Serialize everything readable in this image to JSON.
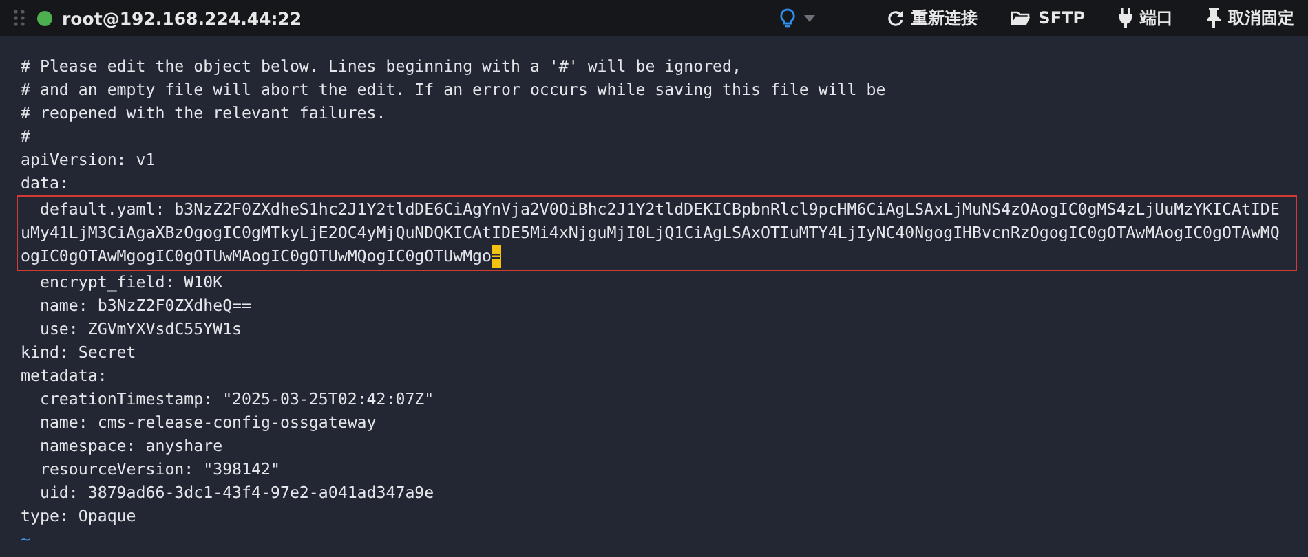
{
  "titlebar": {
    "connected": true,
    "title": "root@192.168.224.44:22",
    "actions": [
      {
        "kind": "reconnect",
        "label": "重新连接"
      },
      {
        "kind": "sftp",
        "label": "SFTP"
      },
      {
        "kind": "port",
        "label": "端口"
      },
      {
        "kind": "unpin",
        "label": "取消固定"
      }
    ]
  },
  "editor": {
    "lines": [
      {
        "text": "# Please edit the object below. Lines beginning with a '#' will be ignored,",
        "highlighted": false
      },
      {
        "text": "# and an empty file will abort the edit. If an error occurs while saving this file will be",
        "highlighted": false
      },
      {
        "text": "# reopened with the relevant failures.",
        "highlighted": false
      },
      {
        "text": "#",
        "highlighted": false
      },
      {
        "text": "apiVersion: v1",
        "highlighted": false
      },
      {
        "text": "data:",
        "highlighted": false
      },
      {
        "text": "  default.yaml: b3NzZ2F0ZXdheS1hc2J1Y2tldDE6CiAgYnVja2V0OiBhc2J1Y2tldDEKICBpbnRlcl9pcHM6CiAgLSAxLjMuNS4zOAogIC0gMS4zLjUuMzYKICAtIDE",
        "highlighted": true
      },
      {
        "text": "uMy41LjM3CiAgaXBzOgogIC0gMTkyLjE2OC4yMjQuNDQKICAtIDE5Mi4xNjguMjI0LjQ1CiAgLSAxOTIuMTY4LjIyNC40NgogIHBvcnRzOgogIC0gOTAwMAogIC0gOTAwMQ",
        "highlighted": true
      },
      {
        "text": "ogIC0gOTAwMgogIC0gOTUwMAogIC0gOTUwMQogIC0gOTUwMgo",
        "highlighted": true,
        "cursor": "="
      },
      {
        "text": "  encrypt_field: W10K",
        "highlighted": false
      },
      {
        "text": "  name: b3NzZ2F0ZXdheQ==",
        "highlighted": false
      },
      {
        "text": "  use: ZGVmYXVsdC55YW1s",
        "highlighted": false
      },
      {
        "text": "kind: Secret",
        "highlighted": false
      },
      {
        "text": "metadata:",
        "highlighted": false
      },
      {
        "text": "  creationTimestamp: \"2025-03-25T02:42:07Z\"",
        "highlighted": false
      },
      {
        "text": "  name: cms-release-config-ossgateway",
        "highlighted": false
      },
      {
        "text": "  namespace: anyshare",
        "highlighted": false
      },
      {
        "text": "  resourceVersion: \"398142\"",
        "highlighted": false
      },
      {
        "text": "  uid: 3879ad66-3dc1-43f4-97e2-a041ad347a9e",
        "highlighted": false
      },
      {
        "text": "type: Opaque",
        "highlighted": false
      }
    ],
    "tilde": "~"
  }
}
